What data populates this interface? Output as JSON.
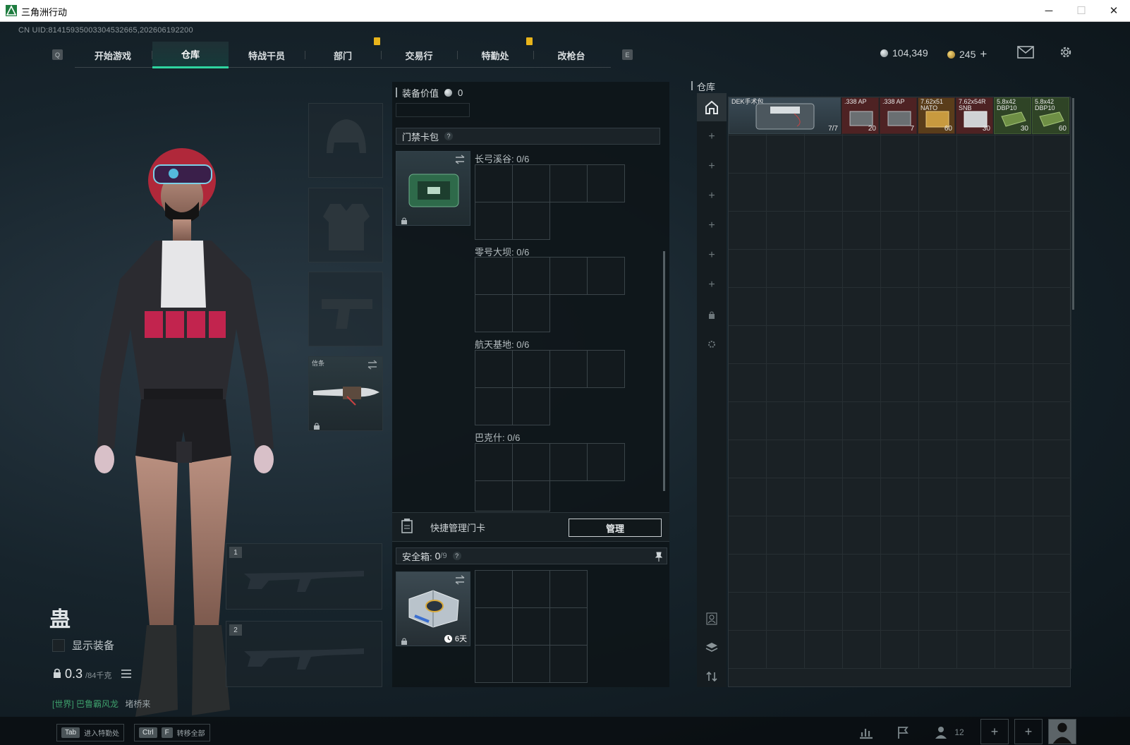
{
  "window": {
    "title": "三角洲行动",
    "min": "─",
    "max": "☐",
    "close": "✕"
  },
  "uid": "CN UID:81415935003304532665,202606192200",
  "nav": {
    "key_left": "Q",
    "key_right": "E",
    "tabs": [
      "开始游戏",
      "仓库",
      "特战干员",
      "部门",
      "交易行",
      "特勤处",
      "改枪台"
    ],
    "active": "仓库"
  },
  "currency": {
    "silver": "104,349",
    "gold": "245",
    "gold_plus": "+"
  },
  "character": {
    "name": "蛊",
    "show_equipment_label": "显示装备",
    "weight": "0.3",
    "weight_unit": "/84千克",
    "chat_channel": "[世界]",
    "chat_user": "巴鲁霸风龙",
    "chat_text": "堵桥来"
  },
  "loadout": {
    "melee_label": "信条",
    "weapon_slot_1": "1",
    "weapon_slot_2": "2"
  },
  "middle": {
    "equip_value_label": "装备价值",
    "equip_value": "0",
    "keycard_section": "门禁卡包",
    "maps": [
      {
        "name": "长弓溪谷:",
        "count": "0/6"
      },
      {
        "name": "零号大坝:",
        "count": "0/6"
      },
      {
        "name": "航天基地:",
        "count": "0/6"
      },
      {
        "name": "巴克什:",
        "count": "0/6"
      }
    ],
    "quick_manage_label": "快捷管理门卡",
    "manage_button": "管理",
    "safebox_label": "安全箱:",
    "safebox_count": "0",
    "safebox_cap": "/9",
    "safebox_timer": "6天"
  },
  "stash": {
    "title": "仓库",
    "items": [
      {
        "label": "DEK手术包",
        "count": "7/7",
        "color": "#3c4d57"
      },
      {
        "label": ".338 AP",
        "count": "20",
        "color": "#5a2323"
      },
      {
        "label": ".338 AP",
        "count": "7",
        "color": "#5a2323"
      },
      {
        "label": "7.62x51 NATO",
        "count": "60",
        "color": "#6b4a1c"
      },
      {
        "label": "7.62x54R SNB",
        "count": "30",
        "color": "#5a2323"
      },
      {
        "label": "5.8x42 DBP10",
        "count": "30",
        "color": "#3d5a2e"
      },
      {
        "label": "5.8x42 DBP10",
        "count": "60",
        "color": "#3d5a2e"
      }
    ]
  },
  "bottom": {
    "hint1_key": "Tab",
    "hint1_text": "进入特勤处",
    "hint2_key1": "Ctrl",
    "hint2_key2": "F",
    "hint2_text": "转移全部",
    "friends_count": "12"
  },
  "colors": {
    "accent": "#2fd5a0",
    "badge": "#e8b41b"
  }
}
